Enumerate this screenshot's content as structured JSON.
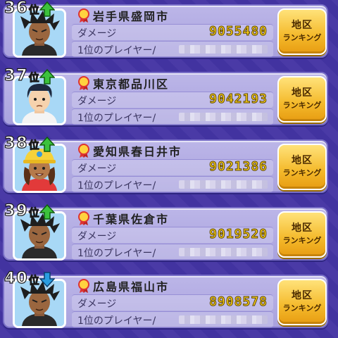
{
  "screen": {
    "rank_suffix": "位",
    "damage_label": "ダメージ",
    "player_label": "1位のプレイヤー/",
    "button_line1": "地区",
    "button_line2": "ランキング",
    "colors": {
      "background": "#4a3aa6",
      "card": "#b3acdf",
      "damage_value": "#ffd21a",
      "button": "#f4b92a",
      "arrow_up": "#3cc23c",
      "arrow_down": "#2a9de0"
    }
  },
  "entries": [
    {
      "rank": "36",
      "trend": "up",
      "trend_icon": "arrow-up-icon",
      "region": "岩手県盛岡市",
      "damage": "9055480",
      "avatar": "dark-hair-hero"
    },
    {
      "rank": "37",
      "trend": "up",
      "trend_icon": "arrow-up-icon",
      "region": "東京都品川区",
      "damage": "9042193",
      "avatar": "boy-white-shirt"
    },
    {
      "rank": "38",
      "trend": "up",
      "trend_icon": "arrow-up-icon",
      "region": "愛知県春日井市",
      "damage": "9021386",
      "avatar": "girl-yellow-cap"
    },
    {
      "rank": "39",
      "trend": "up",
      "trend_icon": "arrow-up-icon",
      "region": "千葉県佐倉市",
      "damage": "9019520",
      "avatar": "dark-hair-hero"
    },
    {
      "rank": "40",
      "trend": "down",
      "trend_icon": "arrow-down-icon",
      "region": "広島県福山市",
      "damage": "8908578",
      "avatar": "dark-hair-hero"
    }
  ]
}
